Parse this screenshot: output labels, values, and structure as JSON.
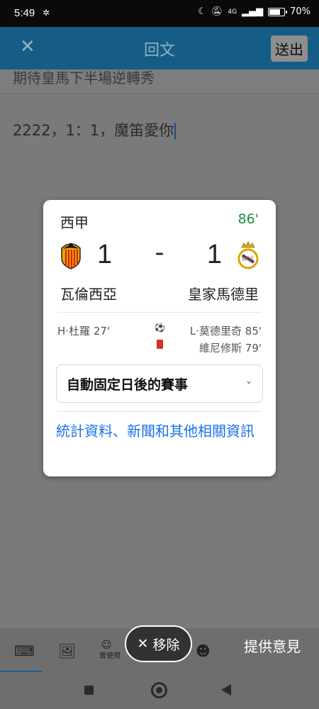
{
  "status_bar": {
    "time": "5:49",
    "network": "4G",
    "battery": "70%",
    "battery_level": 0.7
  },
  "app_bar": {
    "close_icon": "close-icon",
    "title": "回文",
    "send_label": "送出"
  },
  "quoted_text": "期待皇馬下半場逆轉秀",
  "compose_text": "2222，1：1，魔笛愛你",
  "score_card": {
    "league": "西甲",
    "minute": "86'",
    "home": {
      "name": "瓦倫西亞",
      "score": "1",
      "scorers": "H‧杜羅 27'"
    },
    "away": {
      "name": "皇家馬德里",
      "score": "1",
      "scorers": [
        "L‧莫德里奇 85'",
        "維尼修斯 79'"
      ]
    },
    "separator": "-",
    "pin_select": "自動固定日後的賽事",
    "links": "統計資料、新聞和其他相關資訊"
  },
  "toolbar": {
    "used_label": "曾使用",
    "remove_label": "移除",
    "feedback_label": "提供意見"
  },
  "colors": {
    "accent_green": "#1e8e3e",
    "link_blue": "#1a73e8",
    "red_card": "#d93025"
  }
}
